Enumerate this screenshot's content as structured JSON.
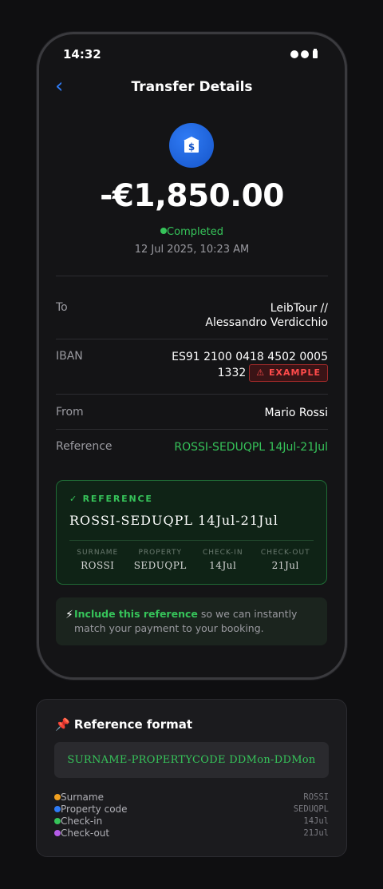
{
  "status_bar": {
    "time": "14:32"
  },
  "nav": {
    "back": "‹",
    "title": "Transfer Details"
  },
  "transfer": {
    "amount": "-€1,850.00",
    "status": "Completed",
    "date": "12 Jul 2025, 10:23 AM"
  },
  "details": {
    "to_label": "To",
    "to_value_line1": "LeibTour //",
    "to_value_line2": "Alessandro Verdicchio",
    "iban_label": "IBAN",
    "iban_line1": "ES91 2100 0418 4502 0005",
    "iban_line2": "1332",
    "example_badge": "⚠ EXAMPLE",
    "from_label": "From",
    "from_value": "Mario Rossi",
    "reference_label": "Reference",
    "reference_value": "ROSSI-SEDUQPL 14Jul-21Jul"
  },
  "ref_card": {
    "title": "✓ REFERENCE",
    "code": "ROSSI-SEDUQPL 14Jul-21Jul",
    "parts": [
      {
        "label": "SURNAME",
        "value": "ROSSI"
      },
      {
        "label": "PROPERTY",
        "value": "SEDUQPL"
      },
      {
        "label": "CHECK-IN",
        "value": "14Jul"
      },
      {
        "label": "CHECK-OUT",
        "value": "21Jul"
      }
    ]
  },
  "tip": {
    "icon": "⚡",
    "strong": "Include this reference",
    "rest": " so we can instantly match your payment to your booking."
  },
  "format": {
    "title": "📌 Reference format",
    "pattern": "SURNAME-PROPERTYCODE DDMon-DDMon",
    "legend": [
      {
        "label": "Surname",
        "example": "ROSSI",
        "color": "#f0a020"
      },
      {
        "label": "Property code",
        "example": "SEDUQPL",
        "color": "#2f7bf5"
      },
      {
        "label": "Check-in",
        "example": "14Jul",
        "color": "#36c45a"
      },
      {
        "label": "Check-out",
        "example": "21Jul",
        "color": "#b45ce8"
      }
    ]
  },
  "colors": {
    "accent_blue": "#2f7bf5",
    "success_green": "#36c45a",
    "warning_red": "#ff4b4b",
    "background": "#0f0f11"
  }
}
